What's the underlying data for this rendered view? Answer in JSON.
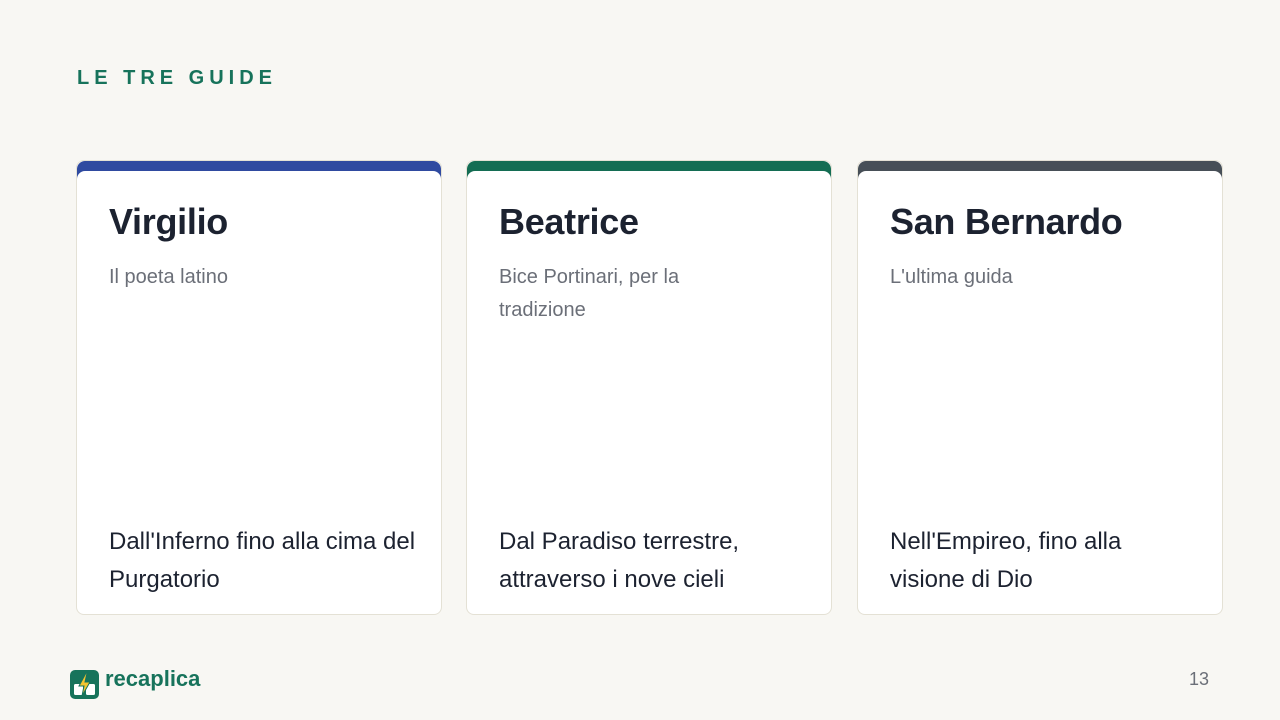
{
  "section_label": "LE TRE GUIDE",
  "cards": [
    {
      "title": "Virgilio",
      "subtitle": "Il poeta latino",
      "body": "Dall'Inferno fino alla cima del Purgatorio",
      "accent": "#2f4aa0"
    },
    {
      "title": "Beatrice",
      "subtitle": "Bice Portinari, per la tradizione",
      "body": "Dal Paradiso terrestre, attraverso i nove cieli",
      "accent": "#146d53"
    },
    {
      "title": "San Bernardo",
      "subtitle": "L'ultima guida",
      "body": "Nell'Empireo, fino alla visione di Dio",
      "accent": "#474f57"
    }
  ],
  "footer": {
    "brand": "recaplica",
    "brand_icon": "recaplica-logo-icon",
    "page_number": "13"
  },
  "colors": {
    "background": "#f8f7f3",
    "brand": "#17735b",
    "text": "#1c2230",
    "muted": "#6b6f78"
  }
}
